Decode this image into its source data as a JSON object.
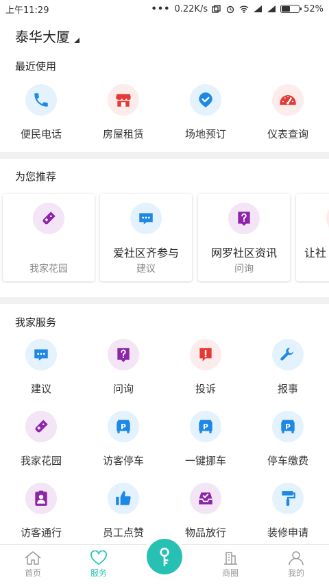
{
  "status_bar": {
    "time": "上午11:29",
    "speed": "0.22K/s",
    "battery": "52%",
    "battery_level": 0.52
  },
  "location": {
    "name": "泰华大厦"
  },
  "recent": {
    "title": "最近使用",
    "items": [
      {
        "label": "便民电话",
        "icon": "phone-icon"
      },
      {
        "label": "房屋租赁",
        "icon": "shop-icon"
      },
      {
        "label": "场地预订",
        "icon": "location-check-icon"
      },
      {
        "label": "仪表查询",
        "icon": "gauge-icon"
      }
    ]
  },
  "recommend": {
    "title": "为您推荐",
    "cards": [
      {
        "title": "",
        "subtitle": "我家花园",
        "icon": "gamepad-icon"
      },
      {
        "title": "爱社区齐参与",
        "subtitle": "建议",
        "icon": "chat-bubble-icon"
      },
      {
        "title": "网罗社区资讯",
        "subtitle": "问询",
        "icon": "question-icon"
      },
      {
        "title": "让社",
        "subtitle": "",
        "icon": ""
      }
    ]
  },
  "services": {
    "title": "我家服务",
    "items": [
      {
        "label": "建议",
        "icon": "chat-bubble-icon"
      },
      {
        "label": "问询",
        "icon": "question-icon"
      },
      {
        "label": "投诉",
        "icon": "complaint-icon"
      },
      {
        "label": "报事",
        "icon": "wrench-icon"
      },
      {
        "label": "我家花园",
        "icon": "gamepad-icon"
      },
      {
        "label": "访客停车",
        "icon": "parking-car-icon"
      },
      {
        "label": "一键挪车",
        "icon": "parking-car-icon"
      },
      {
        "label": "停车缴费",
        "icon": "parking-car-icon"
      },
      {
        "label": "访客通行",
        "icon": "badge-icon"
      },
      {
        "label": "员工点赞",
        "icon": "thumbs-up-icon"
      },
      {
        "label": "物品放行",
        "icon": "tray-check-icon"
      },
      {
        "label": "装修申请",
        "icon": "paint-roller-icon"
      }
    ]
  },
  "tabbar": {
    "tabs": [
      {
        "label": "首页",
        "icon": "home-icon"
      },
      {
        "label": "服务",
        "icon": "heart-icon",
        "active": true
      },
      {
        "label": "",
        "icon": "key-icon"
      },
      {
        "label": "商圈",
        "icon": "building-icon"
      },
      {
        "label": "我的",
        "icon": "user-icon"
      }
    ]
  },
  "colors": {
    "accent": "#26c1b3",
    "blue": "#1e88e5",
    "purple": "#8e24aa",
    "red": "#e53935"
  }
}
